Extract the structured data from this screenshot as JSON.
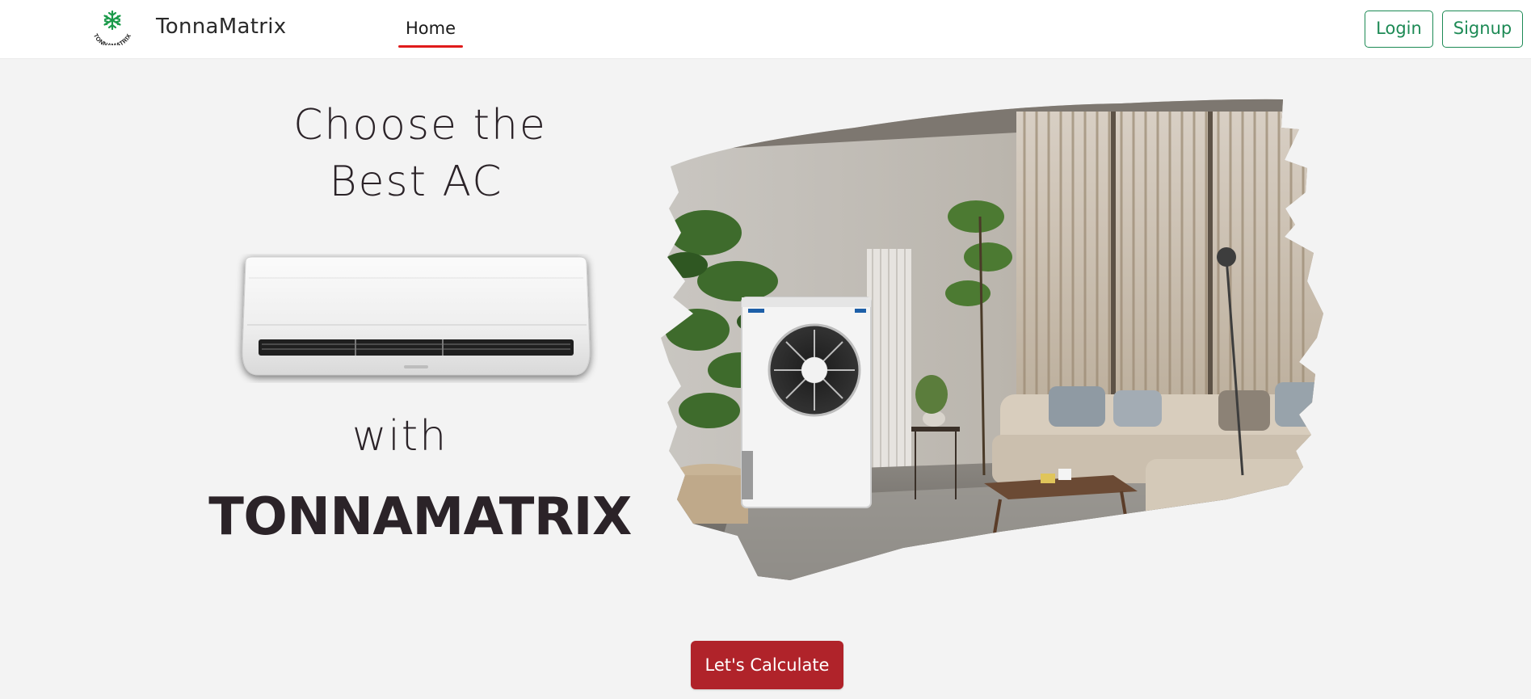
{
  "brand": {
    "name": "TonnaMatrix",
    "logo_icon": "snowflake-icon",
    "logo_text": "TONNAMATRIX",
    "accent_color": "#1d8a55"
  },
  "nav": {
    "items": [
      {
        "label": "Home",
        "active": true,
        "underline_color": "#e01b1b"
      }
    ],
    "login_label": "Login",
    "signup_label": "Signup"
  },
  "hero": {
    "headline_line1": "Choose the",
    "headline_line2": "Best AC",
    "headline_with": "with",
    "brand_title": "TONNAMATRIX",
    "ac_image": "split-ac-unit-image",
    "room_image": "living-room-with-outdoor-ac-unit-image"
  },
  "cta": {
    "label": "Let's Calculate",
    "color": "#b0232a"
  }
}
